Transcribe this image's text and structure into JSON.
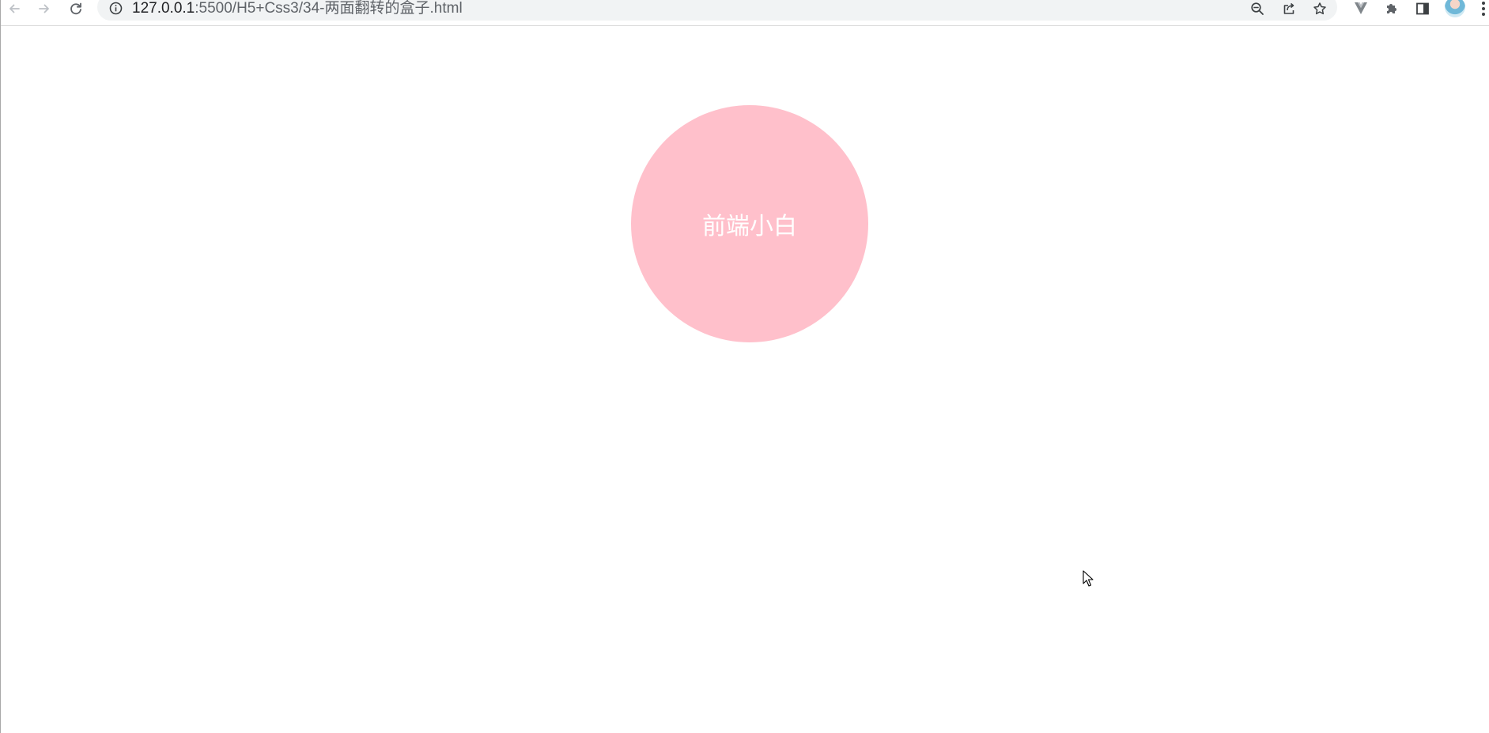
{
  "browser": {
    "url_host": "127.0.0.1",
    "url_rest": ":5500/H5+Css3/34-两面翻转的盒子.html",
    "icons": {
      "back": "arrow-left-icon",
      "forward": "arrow-right-icon",
      "reload": "reload-icon",
      "site_info": "info-icon",
      "zoom": "zoom-out-icon",
      "share": "share-icon",
      "bookmark": "star-icon",
      "extension_vue": "vue-extension-icon",
      "extensions": "puzzle-icon",
      "side_panel": "side-panel-icon",
      "profile": "avatar",
      "menu": "kebab-menu-icon"
    }
  },
  "page": {
    "box_text": "前端小白",
    "box_color": "#ffc0cb",
    "text_color": "#ffffff"
  },
  "colors": {
    "omnibox_bg": "#f1f3f4",
    "icon": "#5f6368",
    "icon_disabled": "#bdc1c6"
  }
}
